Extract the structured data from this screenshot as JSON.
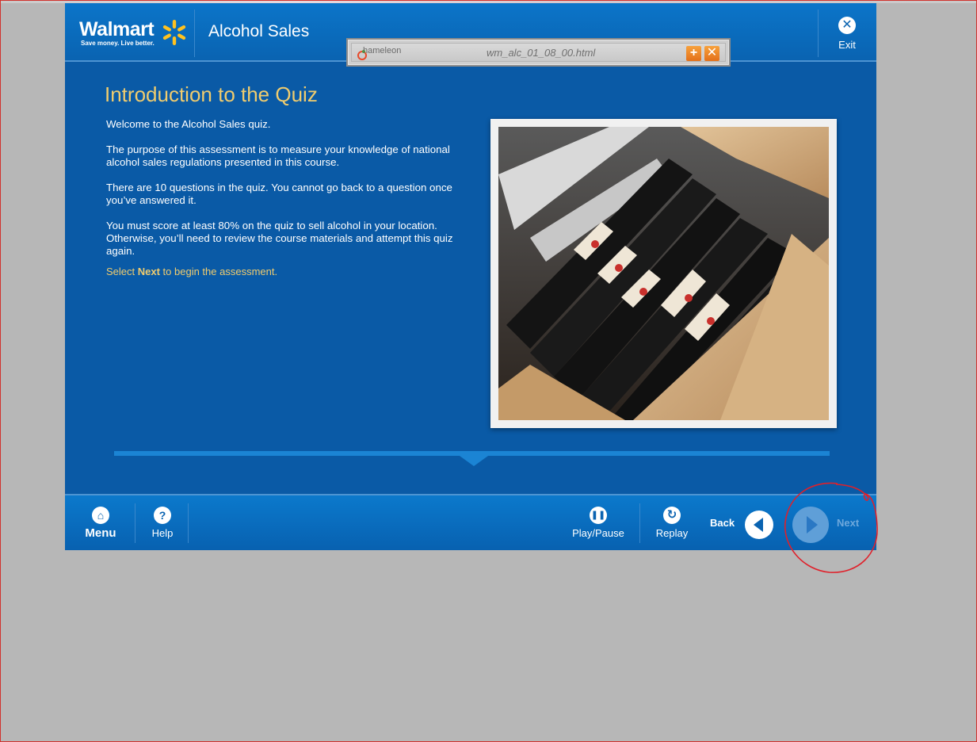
{
  "header": {
    "logo_word": "Walmart",
    "logo_tagline": "Save money. Live better.",
    "course_title": "Alcohol Sales",
    "exit_label": "Exit"
  },
  "popup": {
    "app_name": "hameleon",
    "filename": "wm_alc_01_08_00.html"
  },
  "content": {
    "title": "Introduction to the Quiz",
    "paragraphs": [
      "Welcome to the Alcohol Sales quiz.",
      "The purpose of this assessment is to measure your knowledge of national alcohol sales regulations presented in this course.",
      "There are 10 questions in the quiz.  You cannot go back to a question once you’ve answered it.",
      "You must score at least 80% on the quiz to sell alcohol in your location. Otherwise, you’ll need to review the course materials and attempt this quiz again."
    ],
    "prompt_pre": "Select ",
    "prompt_bold": "Next",
    "prompt_post": " to begin the assessment."
  },
  "footer": {
    "menu_label": "Menu",
    "help_label": "Help",
    "playpause_label": "Play/Pause",
    "replay_label": "Replay",
    "back_label": "Back",
    "next_label": "Next"
  },
  "colors": {
    "player_bg": "#0a5aa6",
    "accent_gold": "#f0cc6e",
    "spark_yellow": "#ffc220",
    "annotation_red": "#e0202a"
  },
  "icons": [
    "spark-icon",
    "close-icon",
    "home-icon",
    "help-icon",
    "pause-icon",
    "replay-icon",
    "back-arrow-icon",
    "next-arrow-icon",
    "plus-icon"
  ]
}
